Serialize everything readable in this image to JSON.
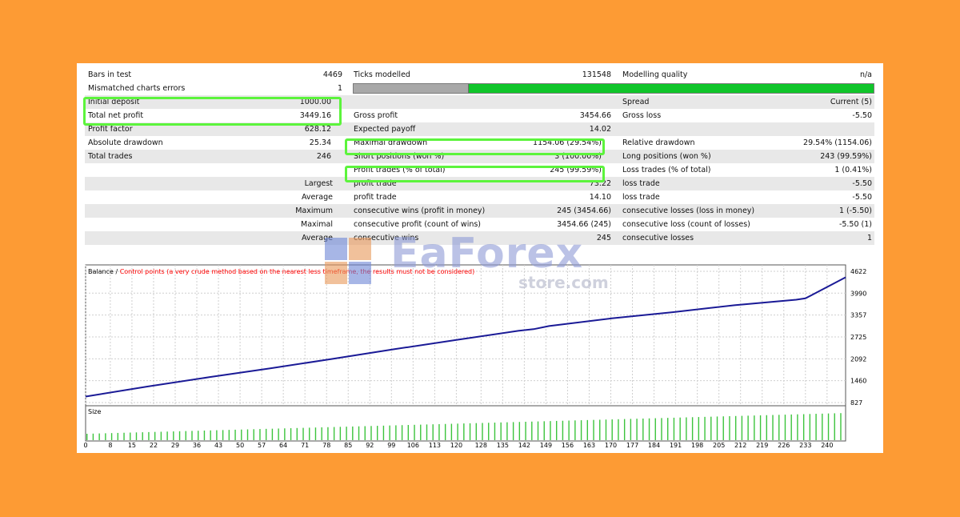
{
  "stats": {
    "bars_label": "Bars in test",
    "bars_value": "4469",
    "ticks_label": "Ticks modelled",
    "ticks_value": "131548",
    "quality_label": "Modelling quality",
    "quality_value": "n/a",
    "mismatch_label": "Mismatched charts errors",
    "mismatch_value": "1",
    "deposit_label": "Initial deposit",
    "deposit_value": "1000.00",
    "spread_label": "Spread",
    "spread_value": "Current (5)",
    "netprofit_label": "Total net profit",
    "netprofit_value": "3449.16",
    "grossprofit_label": "Gross profit",
    "grossprofit_value": "3454.66",
    "grossloss_label": "Gross loss",
    "grossloss_value": "-5.50",
    "pf_label": "Profit factor",
    "pf_value": "628.12",
    "payoff_label": "Expected payoff",
    "payoff_value": "14.02",
    "absdd_label": "Absolute drawdown",
    "absdd_value": "25.34",
    "maxdd_label": "Maximal drawdown",
    "maxdd_value": "1154.06 (29.54%)",
    "reldd_label": "Relative drawdown",
    "reldd_value": "29.54% (1154.06)",
    "trades_label": "Total trades",
    "trades_value": "246",
    "short_label": "Short positions (won %)",
    "short_value": "3 (100.00%)",
    "long_label": "Long positions (won %)",
    "long_value": "243 (99.59%)",
    "profittrades_label": "Profit trades (% of total)",
    "profittrades_value": "245 (99.59%)",
    "losstrades_label": "Loss trades (% of total)",
    "losstrades_value": "1 (0.41%)",
    "largest_label": "Largest",
    "largest_pt_label": "profit trade",
    "largest_pt_value": "73.22",
    "largest_lt_label": "loss trade",
    "largest_lt_value": "-5.50",
    "average_label": "Average",
    "average_pt_label": "profit trade",
    "average_pt_value": "14.10",
    "average_lt_label": "loss trade",
    "average_lt_value": "-5.50",
    "maximum_label": "Maximum",
    "maxwins_label": "consecutive wins (profit in money)",
    "maxwins_value": "245 (3454.66)",
    "maxlosses_label": "consecutive losses (loss in money)",
    "maxlosses_value": "1 (-5.50)",
    "maximal_label": "Maximal",
    "maxprofit_label": "consecutive profit (count of wins)",
    "maxprofit_value": "3454.66 (245)",
    "maxloss_label": "consecutive loss (count of losses)",
    "maxloss_value": "-5.50 (1)",
    "avg2_label": "Average",
    "avgwins_label": "consecutive wins",
    "avgwins_value": "245",
    "avglosses_label": "consecutive losses",
    "avglosses_value": "1"
  },
  "quality_bar": {
    "gray_fraction": 0.22,
    "gray_color": "#a8a8a8",
    "green_color": "#10c52a"
  },
  "watermark": {
    "brand": "EaForex",
    "sub": "store.com"
  },
  "colors": {
    "highlight": "#5cf43c",
    "balance_line": "#1a1a96",
    "size_bar": "#3cc43c",
    "legend_red": "#ff0000",
    "background": "#fd9b34"
  },
  "chart_data": {
    "type": "line",
    "legend_balance": "Balance",
    "legend_sep": " / ",
    "legend_control": "Control points (a very crude method based on the nearest less timeframe, the results must not be considered)",
    "y_ticks": [
      4622,
      3990,
      3357,
      2725,
      2092,
      1460,
      827
    ],
    "ylim": [
      827,
      4622
    ],
    "x_ticks": [
      0,
      8,
      15,
      22,
      29,
      36,
      43,
      50,
      57,
      64,
      71,
      78,
      85,
      92,
      99,
      106,
      113,
      120,
      128,
      135,
      142,
      149,
      156,
      163,
      170,
      177,
      184,
      191,
      198,
      205,
      212,
      219,
      226,
      233,
      240
    ],
    "xlim": [
      0,
      246
    ],
    "balance": [
      [
        0,
        1000
      ],
      [
        20,
        1290
      ],
      [
        40,
        1560
      ],
      [
        60,
        1820
      ],
      [
        80,
        2090
      ],
      [
        100,
        2370
      ],
      [
        120,
        2640
      ],
      [
        140,
        2900
      ],
      [
        145,
        2950
      ],
      [
        150,
        3040
      ],
      [
        170,
        3260
      ],
      [
        190,
        3440
      ],
      [
        210,
        3640
      ],
      [
        230,
        3800
      ],
      [
        233,
        3840
      ],
      [
        246,
        4449
      ]
    ],
    "size_label": "Size"
  }
}
